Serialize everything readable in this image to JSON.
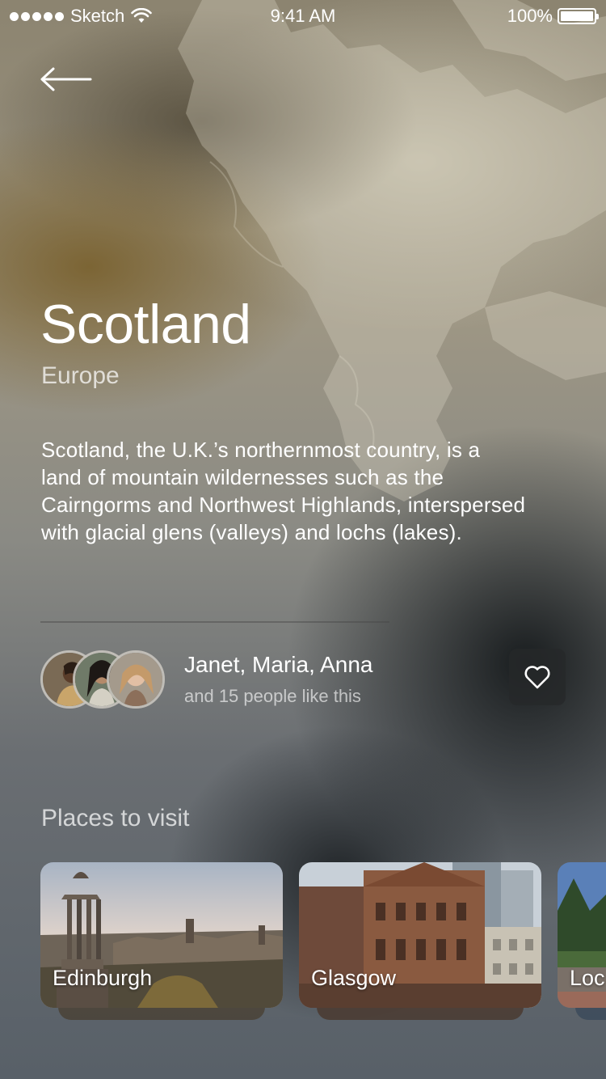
{
  "status_bar": {
    "carrier": "Sketch",
    "time": "9:41 AM",
    "battery": "100%",
    "battery_level": 1.0
  },
  "header": {
    "back_icon": "arrow-left-icon"
  },
  "destination": {
    "title": "Scotland",
    "subtitle": "Europe",
    "description": "Scotland, the U.K.’s northernmost country, is a land of mountain wildernesses such as the Cairngorms and Northwest Highlands, interspersed with glacial glens (valleys) and lochs (lakes)."
  },
  "likes": {
    "names": "Janet, Maria, Anna",
    "count_text": "and 15 people like this",
    "like_icon": "heart-icon"
  },
  "places": {
    "title": "Places to visit",
    "items": [
      {
        "name": "Edinburgh"
      },
      {
        "name": "Glasgow"
      },
      {
        "name": "Loc"
      }
    ]
  }
}
